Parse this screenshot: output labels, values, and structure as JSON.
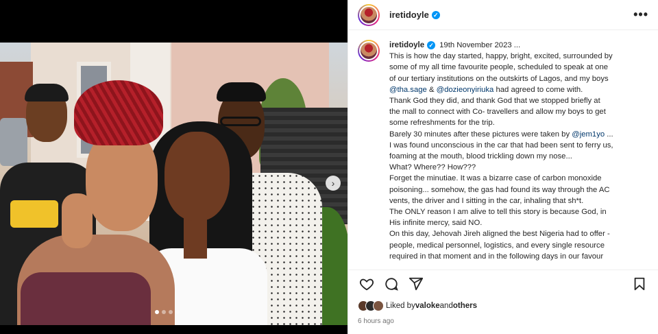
{
  "post": {
    "username": "iretidoyle",
    "verified_mark": "✓",
    "more_label": "•••",
    "next_label": "›"
  },
  "caption": {
    "username": "iretidoyle",
    "date": "19th November 2023 ...",
    "lines": [
      "This is how the day started, happy, bright, excited, surrounded by",
      "some of my all time favourite people, scheduled to speak at one",
      "of our tertiary institutions on the outskirts of Lagos, and my boys"
    ],
    "line4_mention1": "@tha.sage",
    "line4_amp": " & ",
    "line4_mention2": "@dozieonyiriuka",
    "line4_rest": " had agreed to come with.",
    "lines_b": [
      "Thank God they did, and thank God that we stopped briefly at",
      "the mall to connect with Co- travellers and allow my boys to get",
      "some refreshments for the trip."
    ],
    "line8_start": "Barely 30 minutes after these pictures were taken by ",
    "line8_mention": "@jem1yo",
    "line8_end": " ...",
    "lines_c": [
      "I was found unconscious in the car that had been sent to ferry us,",
      "foaming at the mouth, blood trickling down my nose...",
      "What? Where?? How???",
      "Forget the minutiae. It was a bizarre case of carbon monoxide",
      "poisoning... somehow, the gas had found its way through the AC",
      "vents, the driver and I sitting in the car, inhaling that sh*t.",
      "The ONLY reason I am alive to tell this story is because God, in",
      "His infinite mercy, said NO.",
      "On this day, Jehovah Jireh aligned the best Nigeria had to offer -",
      "people, medical personnel, logistics, and every single resource",
      "required in that moment and in the following days in our favour"
    ]
  },
  "likes": {
    "prefix": "Liked by ",
    "user": "valoke",
    "middle": " and ",
    "others": "others"
  },
  "timestamp": "6 hours ago",
  "icons": [
    "heart-icon",
    "comment-icon",
    "share-icon",
    "bookmark-icon",
    "next-arrow-icon",
    "more-options-icon",
    "verified-badge-icon"
  ],
  "carousel": {
    "total": 4,
    "active_index": 1
  },
  "colors": {
    "verified": "#0095f6",
    "mention": "#00376b",
    "muted": "#737373"
  }
}
